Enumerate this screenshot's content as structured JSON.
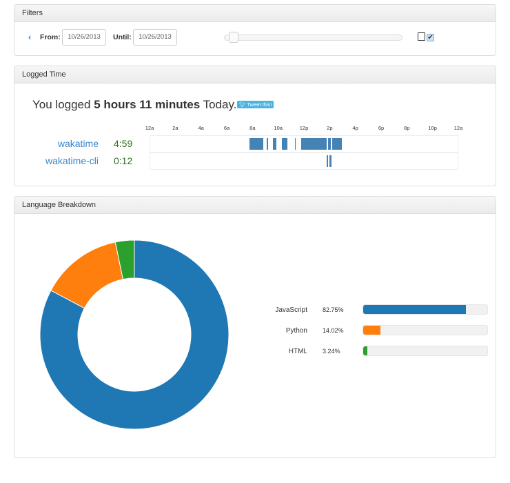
{
  "filters": {
    "title": "Filters",
    "from_label": "From:",
    "from_value": "10/26/2013",
    "until_label": "Until:",
    "until_value": "10/26/2013",
    "slider_value": 0.04
  },
  "logged": {
    "title": "Logged Time",
    "prefix": "You logged ",
    "duration": "5 hours 11 minutes",
    "suffix": " Today.",
    "tweet": "Tweet this!",
    "ticks": [
      "12a",
      "2a",
      "4a",
      "6a",
      "8a",
      "10a",
      "12p",
      "2p",
      "4p",
      "6p",
      "8p",
      "10p",
      "12a"
    ],
    "projects": [
      {
        "name": "wakatime",
        "time": "4:59",
        "segments_hours": [
          [
            7.77,
            8.84
          ],
          [
            9.13,
            9.2
          ],
          [
            9.6,
            9.86
          ],
          [
            10.3,
            10.72
          ],
          [
            11.28,
            11.36
          ],
          [
            11.8,
            13.76
          ],
          [
            13.87,
            14.1
          ],
          [
            14.2,
            14.94
          ]
        ]
      },
      {
        "name": "wakatime-cli",
        "time": "0:12",
        "segments_hours": [
          [
            13.76,
            13.85
          ],
          [
            14.0,
            14.15
          ]
        ]
      }
    ]
  },
  "languages": {
    "title": "Language Breakdown",
    "items": [
      {
        "name": "JavaScript",
        "percent_label": "82.75%",
        "percent": 82.75,
        "color": "#1f77b4"
      },
      {
        "name": "Python",
        "percent_label": "14.02%",
        "percent": 14.02,
        "color": "#ff7f0e"
      },
      {
        "name": "HTML",
        "percent_label": "3.24%",
        "percent": 3.24,
        "color": "#2ca02c"
      }
    ]
  }
}
